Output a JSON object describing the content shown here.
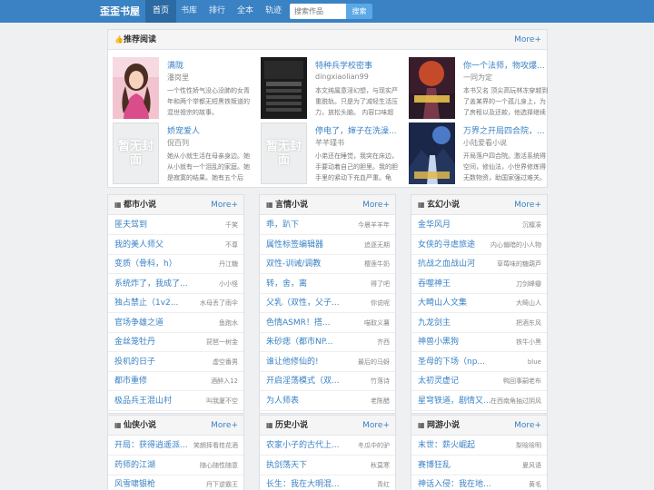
{
  "header": {
    "brand": "歪歪书屋",
    "nav": [
      "首页",
      "书库",
      "排行",
      "全本",
      "轨迹"
    ],
    "search_placeholder": "搜索作品",
    "search_button": "搜索"
  },
  "recommend": {
    "title": "推荐阅读",
    "more": "More+",
    "books": [
      {
        "title": "满陇",
        "author": "潘岗里",
        "desc": "一个性性娇气没心没肺的女青年和两个举都无短黑铁叛道的混世祖宗的故事。",
        "cover_text": ""
      },
      {
        "title": "特种兵学校密事",
        "author": "dingxiaolian99",
        "desc": "本文纯属意淫幻想，与现实严重脱轨。只是为了减轻生活压力，放松头脑。 内容口味超",
        "cover_text": "第一部主同纯生题目"
      },
      {
        "title": "你一个法师，物攻爆...",
        "author": "一同为定",
        "desc": "本书又名 顶尖高玩林冻穿越到了盖某界的一个孤儿身上，为了房租以及还款，他选择继续投",
        "cover_text": ""
      },
      {
        "title": "娇宠爱人",
        "author": "倪百列",
        "desc": "她从小就生活在母亲身边。她从小就有一个泪乱的家庭。她是寂寞的结果。她有五个后",
        "cover_text": "暂无封面"
      },
      {
        "title": "停电了，婶子在洗澡...",
        "author": "芊芊瑾书",
        "desc": "小弟还在睡觉，我突在床边，手要动着自己的胆里。我的胆手里的紧动下充血严重。龟",
        "cover_text": "暂无封面"
      },
      {
        "title": "万界之开局四合院，...",
        "author": "小陆爱看小说",
        "desc": "开局落户四合院。激活系统得空间，修仙法，小世界修炼得无数物资，助国家强过难关。",
        "cover_text": ""
      }
    ]
  },
  "sections": [
    {
      "title": "都市小说",
      "more": "More+",
      "rows": [
        {
          "t": "匪夫驾到",
          "a": "千笑"
        },
        {
          "t": "我的美人师父",
          "a": "不尊"
        },
        {
          "t": "变质（骨科，h）",
          "a": "丹江糖"
        },
        {
          "t": "系统炸了，我成了...",
          "a": "小小怪"
        },
        {
          "t": "独占禁止（1v2...",
          "a": "水母丢了雨伞"
        },
        {
          "t": "官场争雄之道",
          "a": "鱼跑水"
        },
        {
          "t": "金丝笼牡丹",
          "a": "琵琶一树金"
        },
        {
          "t": "投机的日子",
          "a": "虚空番男"
        },
        {
          "t": "都市重修",
          "a": "酒醉入12"
        },
        {
          "t": "极品兵王混山村",
          "a": "叫我厦不空"
        }
      ]
    },
    {
      "title": "言情小说",
      "more": "More+",
      "rows": [
        {
          "t": "乖，趴下",
          "a": "今晨羊羊年"
        },
        {
          "t": "属性标签编辑器",
          "a": "追逐无期"
        },
        {
          "t": "双性-训诫/调教",
          "a": "樱莲牛奶"
        },
        {
          "t": "转，舍，离",
          "a": "得了吧"
        },
        {
          "t": "父乳（双性，父子...",
          "a": "你说呢"
        },
        {
          "t": "色情ASMR！搭...",
          "a": "喵取义薯"
        },
        {
          "t": "朱砂痣（都市NP...",
          "a": "齐西"
        },
        {
          "t": "谁让他修仙的!",
          "a": "最后的马蚜"
        },
        {
          "t": "开启淫荡模式（双...",
          "a": "竹落诗"
        },
        {
          "t": "为人师表",
          "a": "老陈醋"
        }
      ]
    },
    {
      "title": "玄幻小说",
      "more": "More+",
      "rows": [
        {
          "t": "金华风月",
          "a": "沉檀凑"
        },
        {
          "t": "女侠的寻虐旅途",
          "a": "内心偏暗的小人物"
        },
        {
          "t": "抗战之血战山河",
          "a": "草莓味的糖葫芦"
        },
        {
          "t": "吞噬神王",
          "a": "刀剑峰瓣"
        },
        {
          "t": "大畸山人文集",
          "a": "大畸山人"
        },
        {
          "t": "九龙剑主",
          "a": "把酒东风"
        },
        {
          "t": "神兽小黑狗",
          "a": "铁牛小黑"
        },
        {
          "t": "圣母的下场（np...",
          "a": "blue"
        },
        {
          "t": "太初灵虚记",
          "a": "鸭回事嗣老布"
        },
        {
          "t": "星穹铁道，剧情又...",
          "a": "在西南角抽过阴风"
        }
      ]
    },
    {
      "title": "仙侠小说",
      "more": "More+",
      "rows": [
        {
          "t": "开局：获得逍遥派...",
          "a": "笑朗摔看桂花酒"
        },
        {
          "t": "药师的江湖",
          "a": "随心随性随意"
        },
        {
          "t": "风雪啸银枪",
          "a": "丹下逆霸王"
        }
      ]
    },
    {
      "title": "历史小说",
      "more": "More+",
      "rows": [
        {
          "t": "农家小子的古代上...",
          "a": "冬瓜中的驴"
        },
        {
          "t": "执剑荡天下",
          "a": "秋莫寒"
        },
        {
          "t": "长生：我在大明混...",
          "a": "青红"
        }
      ]
    },
    {
      "title": "网游小说",
      "more": "More+",
      "rows": [
        {
          "t": "末世：薪火崛起",
          "a": "梨晗晗明"
        },
        {
          "t": "赛博狂乱",
          "a": "夏风语"
        },
        {
          "t": "神话入侵：我在地...",
          "a": "黄毛"
        }
      ]
    }
  ]
}
